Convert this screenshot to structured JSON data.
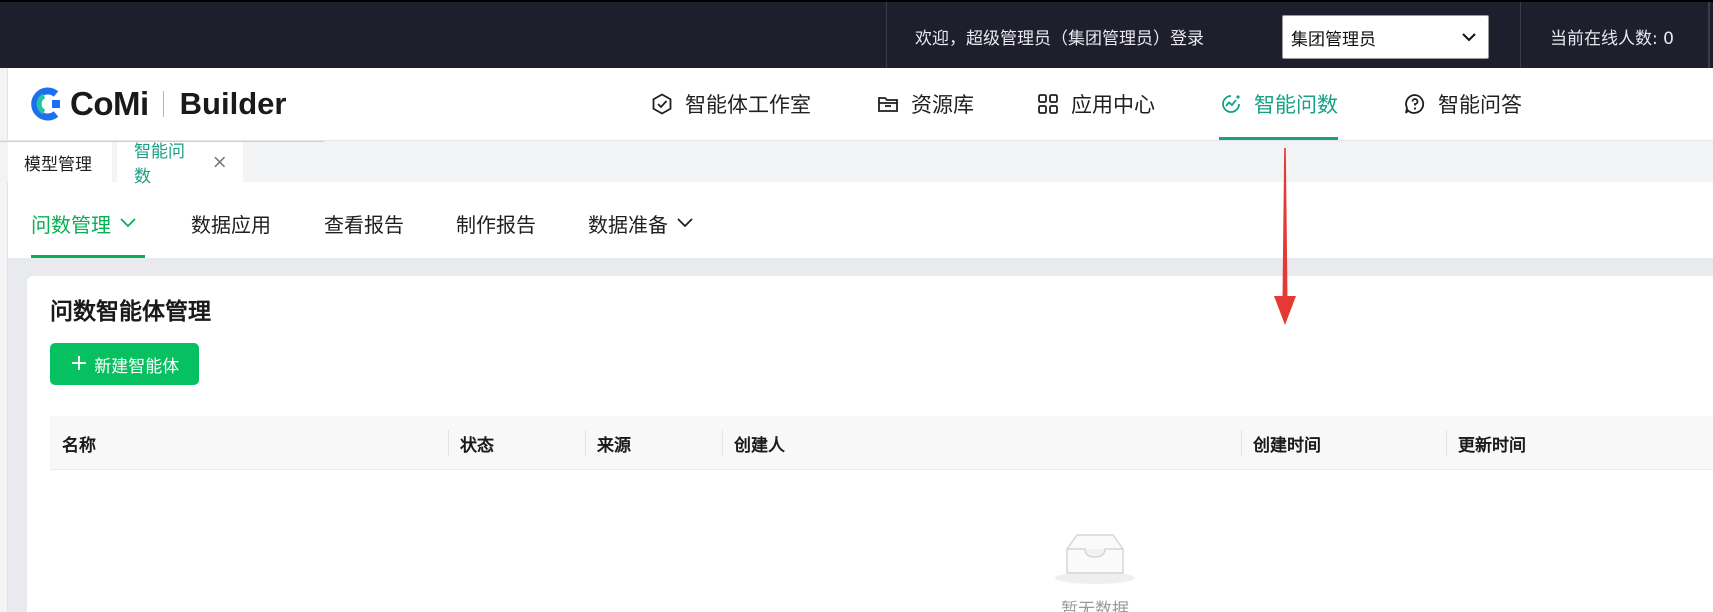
{
  "topbar": {
    "welcome": "欢迎，超级管理员（集团管理员）登录",
    "org_select": "集团管理员",
    "online": "当前在线人数: 0"
  },
  "header": {
    "logo_brand": "CoMi",
    "logo_product": "Builder",
    "nav": [
      {
        "label": "智能体工作室",
        "icon": "agent-studio-icon"
      },
      {
        "label": "资源库",
        "icon": "folder-icon"
      },
      {
        "label": "应用中心",
        "icon": "grid-apps-icon"
      },
      {
        "label": "智能问数",
        "icon": "data-chart-icon",
        "active": true
      },
      {
        "label": "智能问答",
        "icon": "question-chat-icon"
      }
    ]
  },
  "tabs": [
    {
      "label": "模型管理"
    },
    {
      "label": "智能问数",
      "active": true
    }
  ],
  "subnav": [
    {
      "label": "问数管理",
      "active": true,
      "dropdown": true
    },
    {
      "label": "数据应用"
    },
    {
      "label": "查看报告"
    },
    {
      "label": "制作报告"
    },
    {
      "label": "数据准备",
      "dropdown": true
    }
  ],
  "main": {
    "title": "问数智能体管理",
    "new_button": "新建智能体",
    "table": {
      "columns": [
        "名称",
        "状态",
        "来源",
        "创建人",
        "创建时间",
        "更新时间"
      ],
      "rows": [],
      "empty_text": "暂无数据"
    }
  },
  "colors": {
    "accent_teal": "#16a085",
    "accent_green": "#07c160",
    "topbar_bg": "#1e1e2c",
    "annotation_red": "#e53935"
  }
}
